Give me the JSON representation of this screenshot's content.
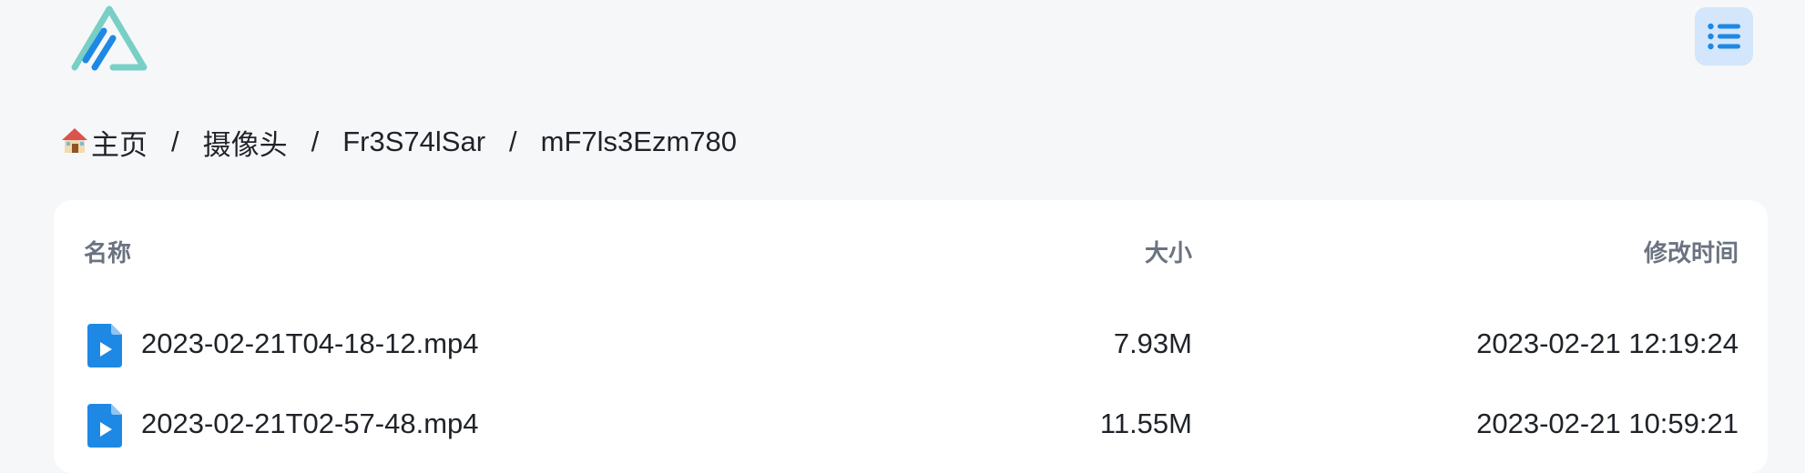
{
  "header": {
    "logo_icon": "alist-logo-icon",
    "menu_icon": "list-menu-icon",
    "accent_color": "#1e88e5",
    "logo_color": "#78cfc6"
  },
  "breadcrumb": {
    "home_icon": "house-icon",
    "home_label": "主页",
    "separator": "/",
    "items": [
      "摄像头",
      "Fr3S74lSar",
      "mF7ls3Ezm780"
    ]
  },
  "table": {
    "columns": {
      "name": "名称",
      "size": "大小",
      "modified": "修改时间"
    },
    "rows": [
      {
        "icon": "video-file-icon",
        "name": "2023-02-21T04-18-12.mp4",
        "size": "7.93M",
        "modified": "2023-02-21 12:19:24"
      },
      {
        "icon": "video-file-icon",
        "name": "2023-02-21T02-57-48.mp4",
        "size": "11.55M",
        "modified": "2023-02-21 10:59:21"
      }
    ]
  }
}
